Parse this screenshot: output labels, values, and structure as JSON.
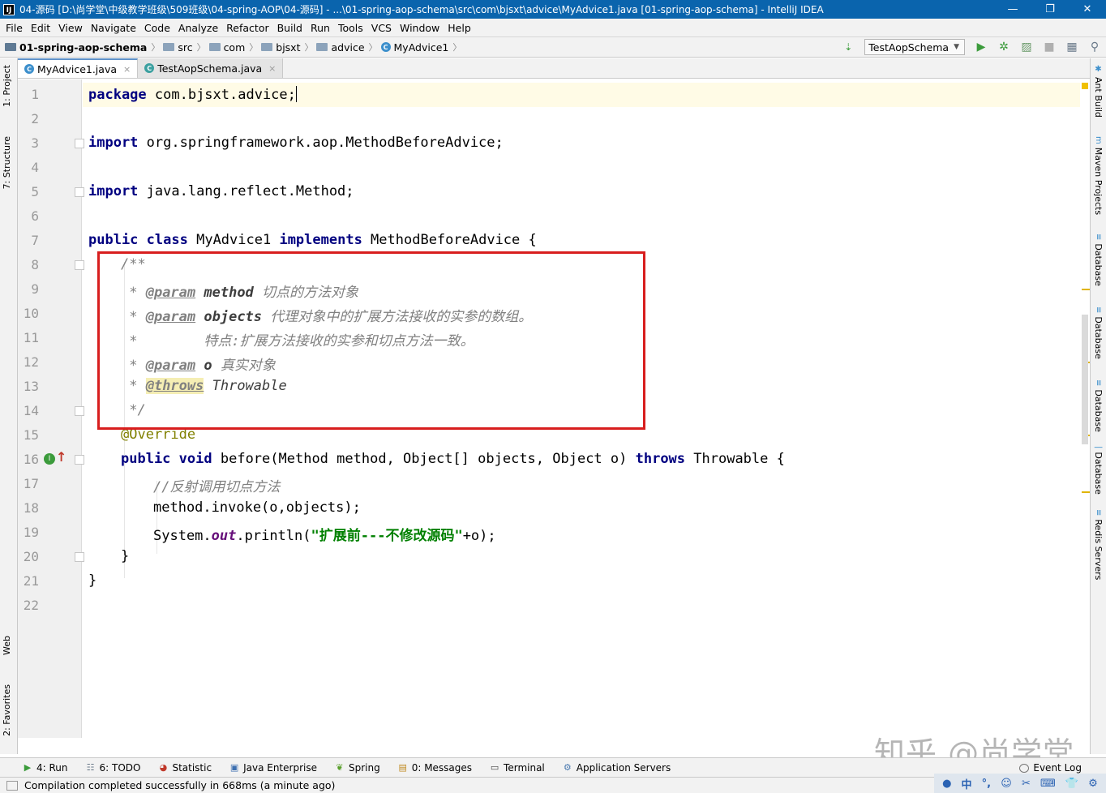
{
  "window": {
    "title": "04-源码 [D:\\尚学堂\\中级教学班级\\509班级\\04-spring-AOP\\04-源码] - ...\\01-spring-aop-schema\\src\\com\\bjsxt\\advice\\MyAdvice1.java [01-spring-aop-schema] - IntelliJ IDEA",
    "app_icon": "IJ",
    "minimize": "—",
    "maximize": "❐",
    "close": "✕"
  },
  "menu": [
    "File",
    "Edit",
    "View",
    "Navigate",
    "Code",
    "Analyze",
    "Refactor",
    "Build",
    "Run",
    "Tools",
    "VCS",
    "Window",
    "Help"
  ],
  "breadcrumb": [
    "01-spring-aop-schema",
    "src",
    "com",
    "bjsxt",
    "advice",
    "MyAdvice1"
  ],
  "run_config": "TestAopSchema",
  "left_tabs": [
    "1: Project",
    "7: Structure",
    "Web",
    "2: Favorites"
  ],
  "right_tabs": [
    "Ant Build",
    "Maven Projects",
    "Database",
    "Database",
    "Database",
    "Database",
    "Redis Servers"
  ],
  "tabs": [
    {
      "label": "MyAdvice1.java",
      "active": true
    },
    {
      "label": "TestAopSchema.java",
      "active": false
    }
  ],
  "line_numbers": [
    "1",
    "2",
    "3",
    "4",
    "5",
    "6",
    "7",
    "8",
    "9",
    "10",
    "11",
    "12",
    "13",
    "14",
    "15",
    "16",
    "17",
    "18",
    "19",
    "20",
    "21",
    "22"
  ],
  "code": {
    "l1_kw": "package",
    "l1_rest": " com.bjsxt.advice;",
    "l3_kw": "import",
    "l3_rest": " org.springframework.aop.MethodBeforeAdvice;",
    "l5_kw": "import",
    "l5_rest": " java.lang.reflect.Method;",
    "l7_kw1": "public",
    "l7_kw2": "class",
    "l7_name": " MyAdvice1 ",
    "l7_kw3": "implements",
    "l7_rest": " MethodBeforeAdvice {",
    "l8": "/**",
    "l9_star": " * ",
    "l9_tag": "@param",
    "l9_param": " method",
    "l9_desc": " 切点的方法对象",
    "l10_star": " * ",
    "l10_tag": "@param",
    "l10_param": " objects",
    "l10_desc": " 代理对象中的扩展方法接收的实参的数组。",
    "l11": " *        特点:扩展方法接收的实参和切点方法一致。",
    "l12_star": " * ",
    "l12_tag": "@param",
    "l12_param": " o",
    "l12_desc": " 真实对象",
    "l13_star": " * ",
    "l13_tag": "@throws",
    "l13_desc": " Throwable",
    "l14": " */",
    "l15": "@Override",
    "l16_kw1": "public",
    "l16_kw2": "void",
    "l16_mid": " before(Method method, Object[] objects, Object o) ",
    "l16_kw3": "throws",
    "l16_rest": " Throwable {",
    "l17": "//反射调用切点方法",
    "l18": "method.invoke(o,objects);",
    "l19_a": "System.",
    "l19_field": "out",
    "l19_b": ".println(",
    "l19_str": "\"扩展前---不修改源码\"",
    "l19_c": "+o);",
    "l20": "}",
    "l21": "}"
  },
  "gutter_badge": "I",
  "bottom_tools": [
    "4: Run",
    "6: TODO",
    "Statistic",
    "Java Enterprise",
    "Spring",
    "0: Messages",
    "Terminal",
    "Application Servers"
  ],
  "event_log": "Event Log",
  "status": "Compilation completed successfully in 668ms (a minute ago)",
  "tray": [
    "中",
    "°,",
    "☺",
    "⌨",
    "👕",
    "⚙"
  ],
  "watermark": "知乎 @尚学堂",
  "colors": {
    "keyword": "#000080",
    "comment": "#808080",
    "string": "#008000",
    "annotation": "#808000",
    "highlight_box": "#d81e1e",
    "title_bar": "#0a64ad"
  }
}
